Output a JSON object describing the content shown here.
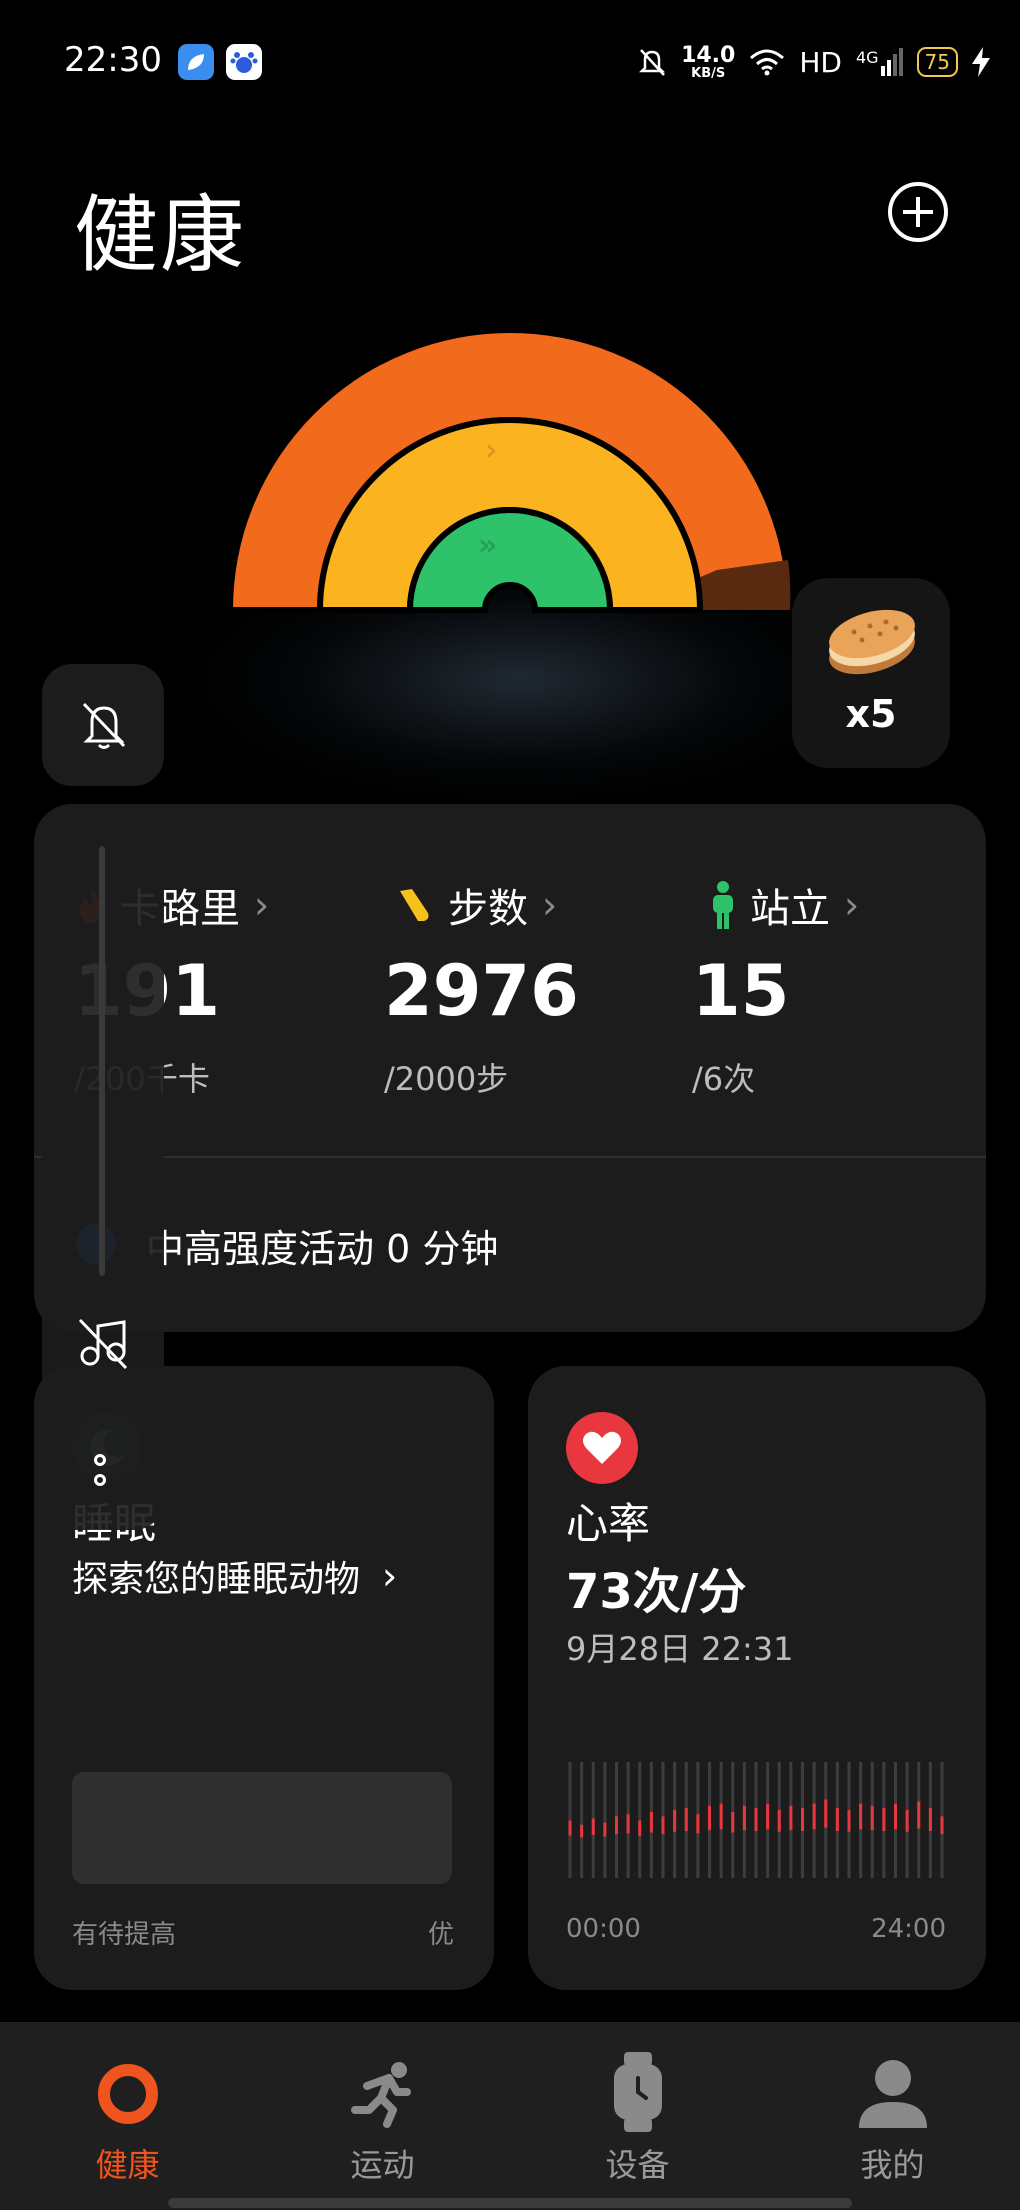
{
  "status_bar": {
    "time": "22:30",
    "net_speed_value": "14.0",
    "net_speed_unit": "KB/S",
    "hd": "HD",
    "signal": "4G",
    "battery": "75"
  },
  "header": {
    "title": "健康"
  },
  "reward": {
    "count": "x5"
  },
  "activity": {
    "calories": {
      "label": "卡路里",
      "value": "191",
      "goal": "/200千卡"
    },
    "steps": {
      "label": "步数",
      "value": "2976",
      "goal": "/2000步"
    },
    "stand": {
      "label": "站立",
      "value": "15",
      "goal": "/6次"
    },
    "intensity": "中高强度活动 0 分钟"
  },
  "sleep": {
    "title": "睡眠",
    "subtitle": "探索您的睡眠动物",
    "scale_low": "有待提高",
    "scale_high": "优"
  },
  "heart_rate": {
    "title": "心率",
    "value": "73次/分",
    "timestamp": "9月28日 22:31",
    "axis_start": "00:00",
    "axis_end": "24:00"
  },
  "tabs": [
    {
      "label": "健康",
      "active": true
    },
    {
      "label": "运动",
      "active": false
    },
    {
      "label": "设备",
      "active": false
    },
    {
      "label": "我的",
      "active": false
    }
  ],
  "colors": {
    "accent": "#f0541e",
    "ring_outer": "#f26a1b",
    "ring_middle": "#fbb31f",
    "ring_inner": "#2ec26a",
    "heart": "#e8373f",
    "steps_icon": "#f5c21b",
    "stand_icon": "#2ec26a"
  }
}
